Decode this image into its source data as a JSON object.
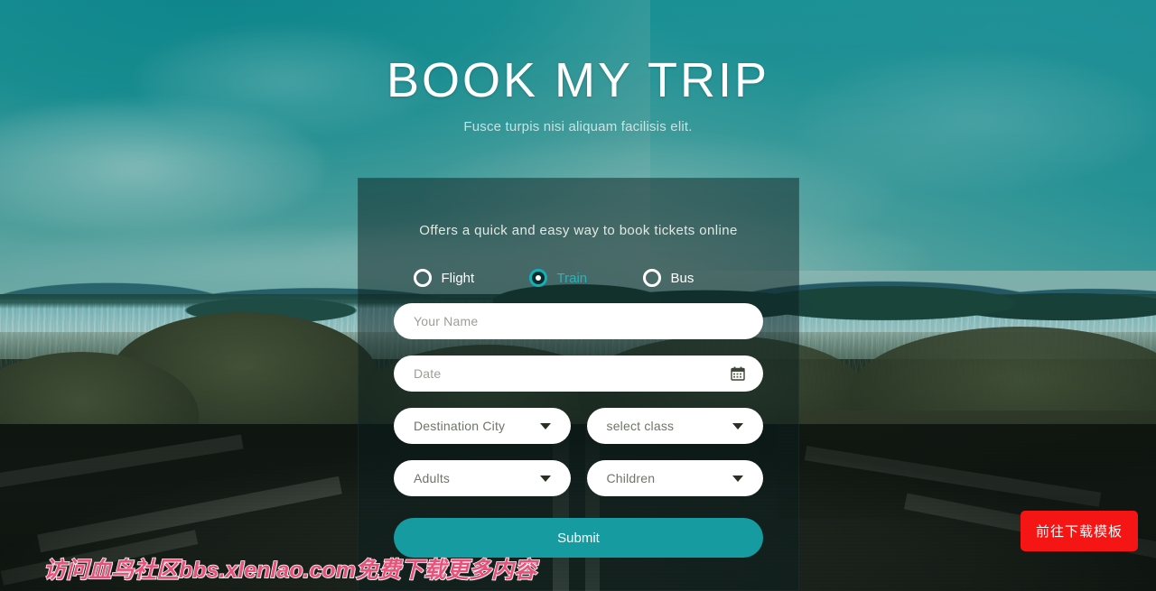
{
  "header": {
    "title": "BOOK MY TRIP",
    "subtitle": "Fusce turpis nisi aliquam facilisis elit."
  },
  "card": {
    "tagline": "Offers a quick and easy way to book tickets online",
    "transport_options": [
      {
        "label": "Flight",
        "selected": false
      },
      {
        "label": "Train",
        "selected": true
      },
      {
        "label": "Bus",
        "selected": false
      }
    ],
    "fields": {
      "name_placeholder": "Your Name",
      "date_placeholder": "Date",
      "destination_placeholder": "Destination City",
      "class_placeholder": "select class",
      "adults_placeholder": "Adults",
      "children_placeholder": "Children"
    },
    "submit_label": "Submit"
  },
  "overlay": {
    "watermark": "访问血鸟社区bbs.xlenlao.com免费下载更多内容",
    "cta_label": "前往下载模板"
  },
  "icons": {
    "calendar": "calendar-icon",
    "chevron": "chevron-down-icon"
  },
  "colors": {
    "accent_teal": "#159ba0",
    "selected_radio": "#2ab3bb",
    "cta_red": "#f51515",
    "watermark_pink": "#e8527a"
  }
}
